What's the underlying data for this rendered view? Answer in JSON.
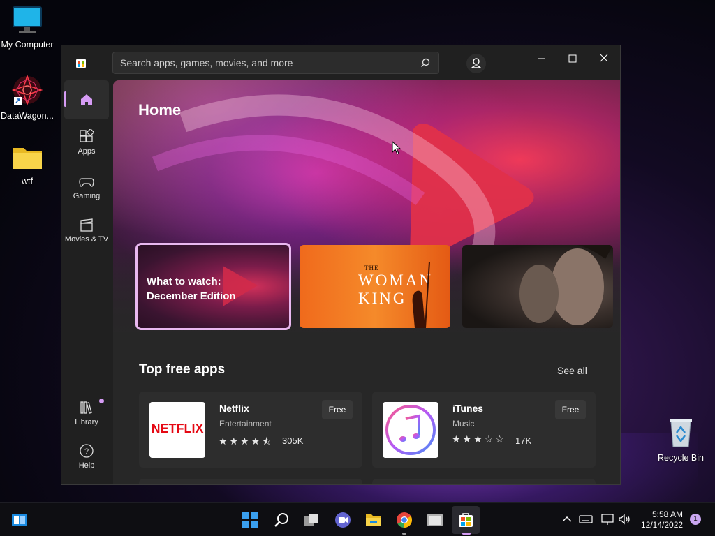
{
  "desktop": {
    "icons": [
      {
        "label": "My Computer"
      },
      {
        "label": "DataWagon..."
      },
      {
        "label": "wtf"
      },
      {
        "label": "Recycle Bin"
      }
    ]
  },
  "window": {
    "search": {
      "placeholder": "Search apps, games, movies, and more"
    },
    "sidebar": [
      {
        "label": "Home",
        "icon": "home-icon"
      },
      {
        "label": "Apps",
        "icon": "apps-icon"
      },
      {
        "label": "Gaming",
        "icon": "gamepad-icon"
      },
      {
        "label": "Movies & TV",
        "icon": "clapperboard-icon"
      },
      {
        "label": "Library",
        "icon": "library-icon"
      },
      {
        "label": "Help",
        "icon": "help-icon"
      }
    ],
    "page_title": "Home",
    "hero_cards": [
      {
        "line1": "What to watch:",
        "line2": "December Edition"
      },
      {
        "small": "THE",
        "title": "WOMAN KING"
      },
      {
        "title": ""
      }
    ],
    "section": {
      "title": "Top free apps",
      "see_all": "See all"
    },
    "apps": [
      {
        "name": "Netflix",
        "category": "Entertainment",
        "price": "Free",
        "rating": 4.5,
        "ratings_count": "305K",
        "logo_text": "NETFLIX"
      },
      {
        "name": "iTunes",
        "category": "Music",
        "price": "Free",
        "rating": 3,
        "ratings_count": "17K"
      }
    ]
  },
  "taskbar": {
    "time": "5:58 AM",
    "date": "12/14/2022",
    "notifications": "1"
  },
  "colors": {
    "accent": "#d69cf5",
    "netflix_red": "#e50914",
    "window_bg": "#202020"
  }
}
